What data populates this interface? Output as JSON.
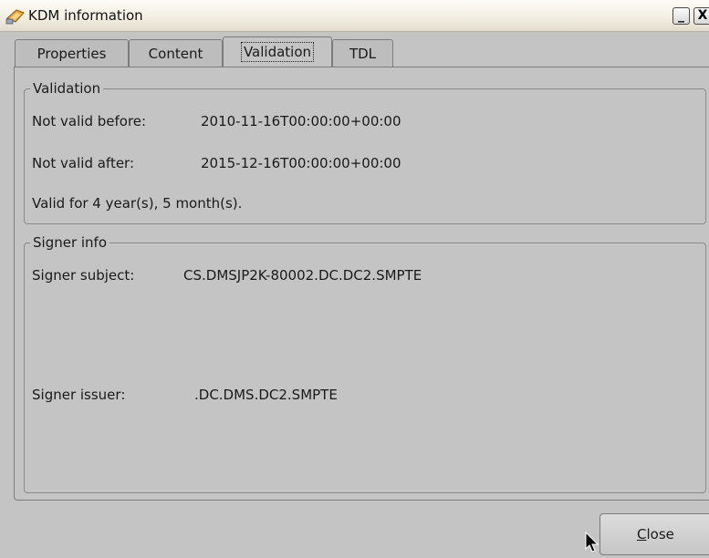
{
  "window": {
    "title": "KDM information",
    "app_icon": "kdm-key-icon",
    "minimize_icon": "minimize-icon",
    "close_icon": "close-x-icon",
    "minimize_glyph": "_",
    "close_glyph": "X"
  },
  "tabs": [
    {
      "label": "Properties",
      "active": false
    },
    {
      "label": "Content",
      "active": false
    },
    {
      "label": "Validation",
      "active": true
    },
    {
      "label": "TDL",
      "active": false
    }
  ],
  "validation": {
    "legend": "Validation",
    "not_valid_before_label": "Not valid before:",
    "not_valid_before_value": "2010-11-16T00:00:00+00:00",
    "not_valid_after_label": "Not valid after:",
    "not_valid_after_value": "2015-12-16T00:00:00+00:00",
    "summary": "Valid for 4 year(s), 5 month(s)."
  },
  "signer": {
    "legend": "Signer info",
    "subject_label": "Signer subject:",
    "subject_value": "CS.DMSJP2K-80002.DC.DC2.SMPTE",
    "issuer_label": "Signer issuer:",
    "issuer_value": ".DC.DMS.DC2.SMPTE"
  },
  "footer": {
    "close_label_mnemonic": "C",
    "close_label_rest": "lose"
  }
}
